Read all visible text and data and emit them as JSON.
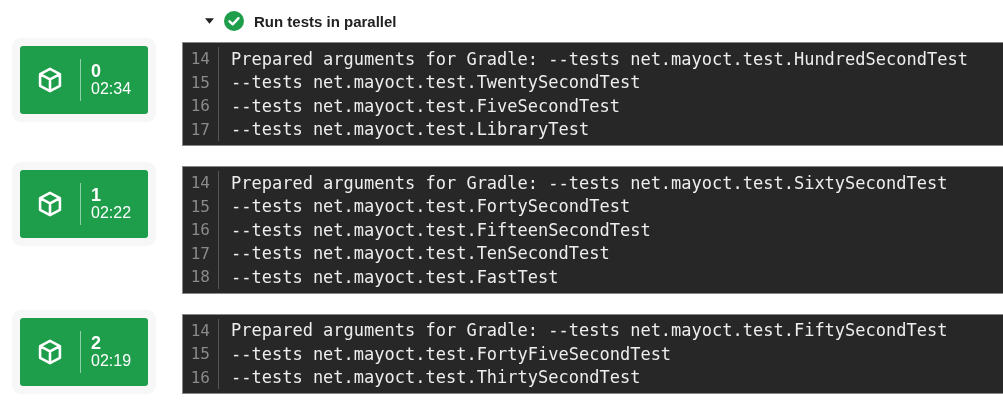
{
  "step": {
    "title": "Run tests in parallel",
    "expanded": true,
    "passed": true
  },
  "shards": [
    {
      "index": "0",
      "duration": "02:34",
      "lines": [
        {
          "number": "14",
          "text": "Prepared arguments for Gradle: --tests net.mayoct.test.HundredSecondTest"
        },
        {
          "number": "15",
          "text": "--tests net.mayoct.test.TwentySecondTest"
        },
        {
          "number": "16",
          "text": "--tests net.mayoct.test.FiveSecondTest"
        },
        {
          "number": "17",
          "text": "--tests net.mayoct.test.LibraryTest"
        }
      ]
    },
    {
      "index": "1",
      "duration": "02:22",
      "lines": [
        {
          "number": "14",
          "text": "Prepared arguments for Gradle: --tests net.mayoct.test.SixtySecondTest"
        },
        {
          "number": "15",
          "text": "--tests net.mayoct.test.FortySecondTest"
        },
        {
          "number": "16",
          "text": "--tests net.mayoct.test.FifteenSecondTest"
        },
        {
          "number": "17",
          "text": "--tests net.mayoct.test.TenSecondTest"
        },
        {
          "number": "18",
          "text": "--tests net.mayoct.test.FastTest"
        }
      ]
    },
    {
      "index": "2",
      "duration": "02:19",
      "lines": [
        {
          "number": "14",
          "text": "Prepared arguments for Gradle: --tests net.mayoct.test.FiftySecondTest"
        },
        {
          "number": "15",
          "text": "--tests net.mayoct.test.FortyFiveSecondTest"
        },
        {
          "number": "16",
          "text": "--tests net.mayoct.test.ThirtySecondTest"
        }
      ]
    }
  ]
}
